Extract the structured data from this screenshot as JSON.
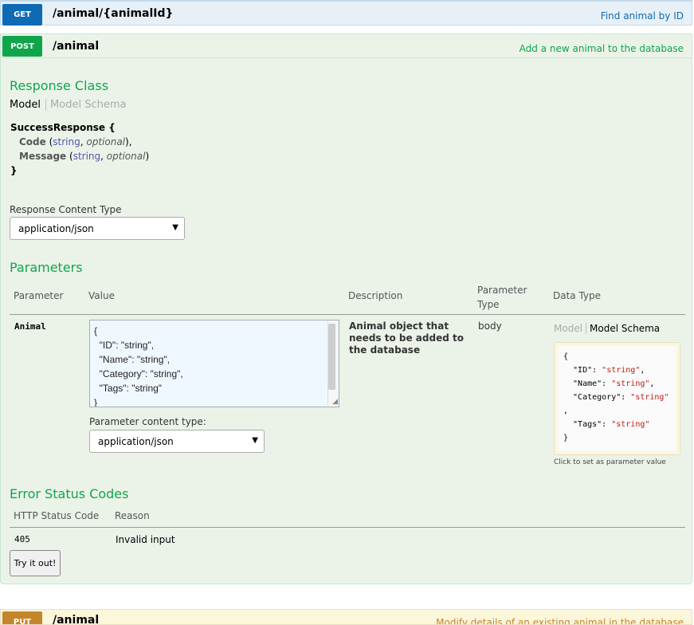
{
  "get_op": {
    "verb": "GET",
    "path": "/animal/{animalId}",
    "summary": "Find animal by ID"
  },
  "post_op": {
    "verb": "POST",
    "path": "/animal",
    "summary": "Add a new animal to the database",
    "response_class": {
      "heading": "Response Class",
      "tab_model": "Model",
      "tab_schema": "Model Schema",
      "model_name": "SuccessResponse {",
      "props": [
        {
          "name": "Code",
          "type": "string",
          "opt": "optional",
          "suffix": "),"
        },
        {
          "name": "Message",
          "type": "string",
          "opt": "optional",
          "suffix": ")"
        }
      ],
      "close": "}"
    },
    "response_content_type": {
      "label": "Response Content Type",
      "value": "application/json"
    },
    "parameters": {
      "heading": "Parameters",
      "columns": {
        "parameter": "Parameter",
        "value": "Value",
        "description": "Description",
        "param_type_1": "Parameter",
        "param_type_2": "Type",
        "data_type": "Data Type"
      },
      "row": {
        "name": "Animal",
        "value": "{\n  \"ID\": \"string\",\n  \"Name\": \"string\",\n  \"Category\": \"string\",\n  \"Tags\": \"string\"\n}",
        "content_type_label": "Parameter content type:",
        "content_type_value": "application/json",
        "description": "Animal object that needs to be added to the database",
        "param_type": "body",
        "dt_tab_model": "Model",
        "dt_tab_schema": "Model Schema",
        "snippet_hint": "Click to set as parameter value"
      }
    },
    "error_codes": {
      "heading": "Error Status Codes",
      "col_code": "HTTP Status Code",
      "col_reason": "Reason",
      "rows": [
        {
          "code": "405",
          "reason": "Invalid input"
        }
      ]
    },
    "try_button": "Try it out!"
  },
  "put_op": {
    "verb": "PUT",
    "path": "/animal",
    "summary": "Modify details of an existing animal in the database"
  },
  "colors": {
    "get": "#0f6ab4",
    "post": "#10a54a",
    "put": "#c5862b"
  }
}
